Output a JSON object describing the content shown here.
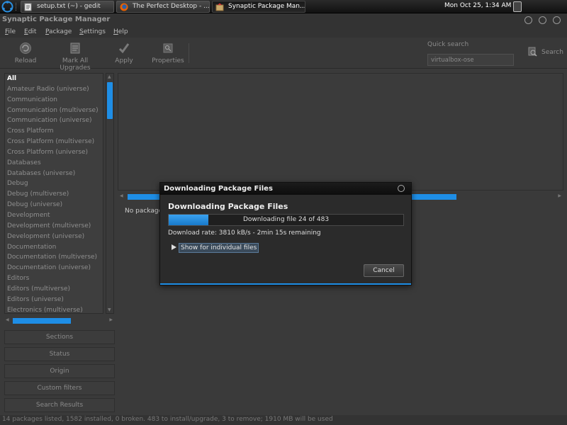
{
  "panel": {
    "tasks": [
      {
        "label": "setup.txt (~) - gedit",
        "icon": "gedit-icon"
      },
      {
        "label": "The Perfect Desktop - ...",
        "icon": "firefox-icon"
      },
      {
        "label": "Synaptic Package Man...",
        "icon": "synaptic-icon"
      }
    ],
    "clock": "Mon Oct 25,  1:34 AM"
  },
  "window": {
    "title": "Synaptic Package Manager"
  },
  "menubar": {
    "items": [
      {
        "first": "F",
        "rest": "ile"
      },
      {
        "first": "E",
        "rest": "dit"
      },
      {
        "first": "P",
        "rest": "ackage"
      },
      {
        "first": "S",
        "rest": "ettings"
      },
      {
        "first": "H",
        "rest": "elp"
      }
    ]
  },
  "toolbar": {
    "reload": "Reload",
    "mark_all": "Mark All Upgrades",
    "apply": "Apply",
    "properties": "Properties",
    "quick_search_label": "Quick search",
    "quick_search_value": "virtualbox-ose",
    "search": "Search"
  },
  "categories": [
    "All",
    "Amateur Radio (universe)",
    "Communication",
    "Communication (multiverse)",
    "Communication (universe)",
    "Cross Platform",
    "Cross Platform (multiverse)",
    "Cross Platform (universe)",
    "Databases",
    "Databases (universe)",
    "Debug",
    "Debug (multiverse)",
    "Debug (universe)",
    "Development",
    "Development (multiverse)",
    "Development (universe)",
    "Documentation",
    "Documentation (multiverse)",
    "Documentation (universe)",
    "Editors",
    "Editors (multiverse)",
    "Editors (universe)",
    "Electronics (multiverse)"
  ],
  "nav_buttons": {
    "sections": "Sections",
    "status": "Status",
    "origin": "Origin",
    "custom_filters": "Custom filters",
    "search_results": "Search Results"
  },
  "package_pane": {
    "no_package_text": "No package"
  },
  "statusbar": {
    "text": "14 packages listed, 1582 installed, 0 broken. 483 to install/upgrade, 3 to remove; 1910 MB will be used"
  },
  "dialog": {
    "title": "Downloading Package Files",
    "heading": "Downloading Package Files",
    "progress_text": "Downloading file 24 of 483",
    "progress_fraction": 0.17,
    "rate_text": "Download rate: 3810 kB/s - 2min 15s remaining",
    "expander_label": "Show for individual files",
    "cancel_label": "Cancel"
  },
  "colors": {
    "accent": "#1e8ee6"
  }
}
